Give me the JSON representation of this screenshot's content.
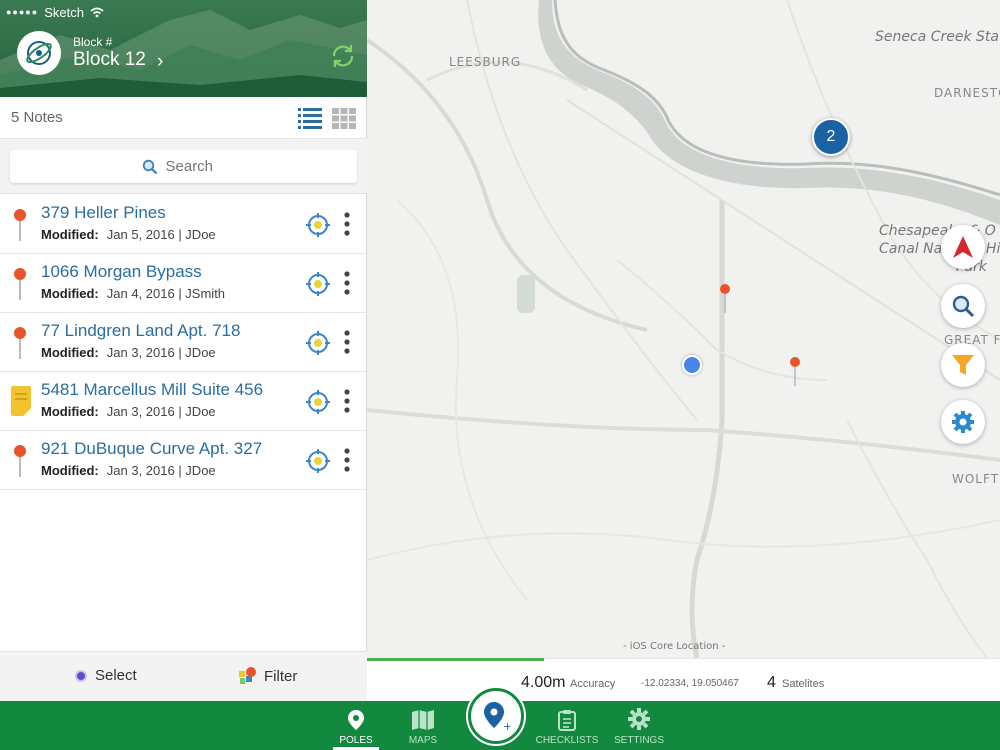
{
  "status_bar": {
    "signal": "●●●●●",
    "carrier": "Sketch"
  },
  "header": {
    "label": "Block #",
    "title": "Block 12"
  },
  "notes_bar": {
    "count_text": "5 Notes"
  },
  "search": {
    "placeholder": "Search"
  },
  "notes": [
    {
      "title": "379 Heller Pines",
      "modified_label": "Modified:",
      "modified": "Jan 5, 2016 | JDoe",
      "icon": "red-pin-icon"
    },
    {
      "title": "1066 Morgan Bypass",
      "modified_label": "Modified:",
      "modified": "Jan 4, 2016 | JSmith",
      "icon": "red-pin-icon"
    },
    {
      "title": "77 Lindgren Land Apt. 718",
      "modified_label": "Modified:",
      "modified": "Jan 3, 2016 | JDoe",
      "icon": "red-pin-icon"
    },
    {
      "title": "5481 Marcellus Mill Suite 456",
      "modified_label": "Modified:",
      "modified": "Jan 3, 2016 | JDoe",
      "icon": "sticky-note-icon"
    },
    {
      "title": "921 DuBuque Curve Apt. 327",
      "modified_label": "Modified:",
      "modified": "Jan 3, 2016 | JDoe",
      "icon": "red-pin-icon"
    }
  ],
  "footer": {
    "select_label": "Select",
    "filter_label": "Filter"
  },
  "map": {
    "labels": {
      "leesburg": "LEESBURG",
      "seneca": "Seneca Creek Sta",
      "darnestown": "DARNESTO",
      "chesapeake_1": "Chesapeake & O",
      "chesapeake_2": "Canal National His",
      "chesapeake_3": "Park",
      "great_falls": "GREAT F",
      "wolf": "WOLFT",
      "core_location": "- iOS Core Location -"
    },
    "cluster_count": "2"
  },
  "accuracy": {
    "value": "4.00m",
    "label": "Accuracy",
    "coords": "-12.02334, 19.050467",
    "satellites_count": "4",
    "satellites_label": "Satelites",
    "progress_fraction": 0.28
  },
  "tabs": [
    {
      "label": "POLES",
      "active": true
    },
    {
      "label": "MAPS",
      "active": false
    },
    {
      "label": "CHECKLISTS",
      "active": false
    },
    {
      "label": "SETTINGS",
      "active": false
    }
  ],
  "colors": {
    "brand_green": "#13883f",
    "link_blue": "#2a6d9e",
    "pin_red": "#e8542a",
    "cluster_blue": "#1a62a3"
  }
}
